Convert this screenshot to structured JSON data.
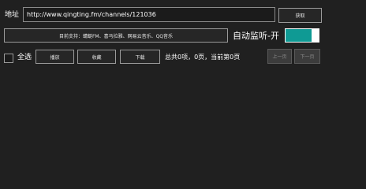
{
  "address": {
    "label": "地址",
    "value": "http://www.qingting.fm/channels/121036"
  },
  "fetch_button": {
    "label": "获取"
  },
  "supported_sources": {
    "label": "目前支持：蜻蜓FM、喜马拉雅、网易云音乐、QQ音乐"
  },
  "auto_monitor": {
    "label": "自动监听-开",
    "state": "on",
    "accent_color": "#0f9a94"
  },
  "select_all": {
    "label": "全选",
    "checked": false
  },
  "actions": {
    "play_label": "播放",
    "favorite_label": "收藏",
    "download_label": "下载"
  },
  "pagination": {
    "summary": "总共0项，0页，当前第0页",
    "prev_label": "上一页",
    "next_label": "下一页"
  }
}
